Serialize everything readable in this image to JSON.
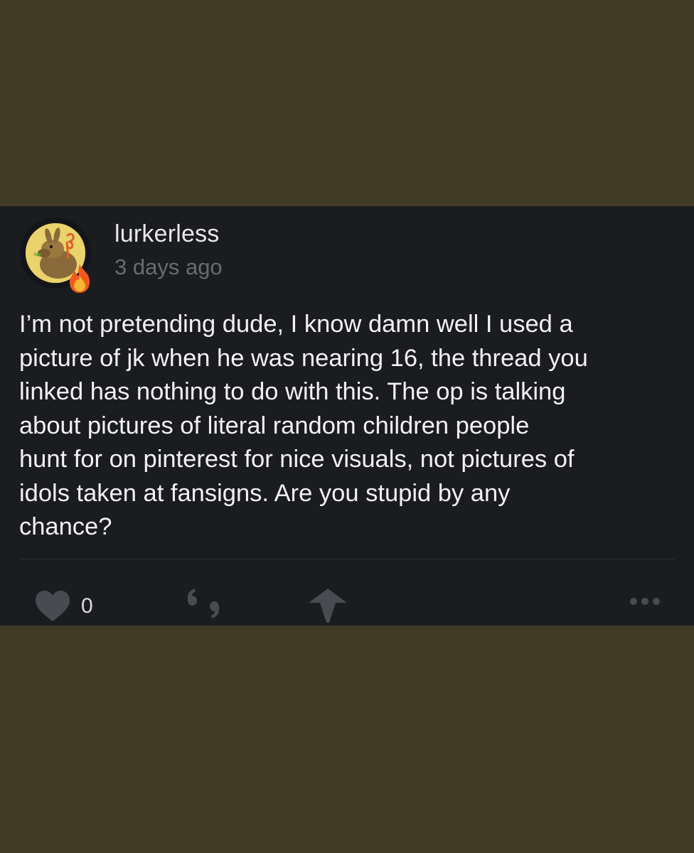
{
  "comment": {
    "username": "lurkerless",
    "timestamp": "3 days ago",
    "body": "I’m not pretending dude, I know damn well I used a\npicture of jk when he was nearing 16, the thread you\nlinked has nothing to do with this. The op is talking\nabout pictures of literal random children people\nhunt for on pinterest for nice visuals, not pictures of\nidols taken at fansigns. Are you stupid by any\nchance?",
    "avatar_icon": "kangaroo-avatar",
    "badge_icon": "fire-icon"
  },
  "actions": {
    "like_icon": "heart-icon",
    "like_count": "0",
    "quote_icon": "quote-icon",
    "share_icon": "share-arrow-icon",
    "more_icon": "more-dots-icon"
  },
  "colors": {
    "background": "#413a25",
    "card": "#1b1c20",
    "text": "#f2f2f2",
    "muted": "#6a6b70",
    "icon": "#4a4b50"
  }
}
